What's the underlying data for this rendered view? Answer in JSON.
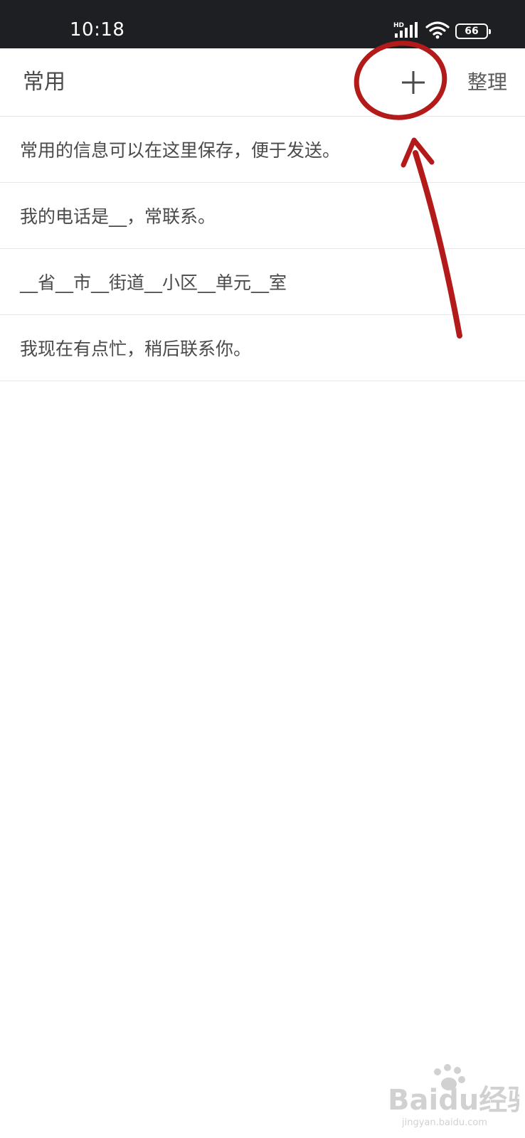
{
  "status_bar": {
    "time": "10:18",
    "network_label": "HD",
    "battery_level": "66",
    "icons": [
      "signal-icon",
      "wifi-icon",
      "battery-icon"
    ]
  },
  "header": {
    "title": "常用",
    "add_icon": "plus-icon",
    "organize_label": "整理"
  },
  "phrases": [
    "常用的信息可以在这里保存，便于发送。",
    "我的电话是__，常联系。",
    "__省__市__街道__小区__单元__室",
    "我现在有点忙，稍后联系你。"
  ],
  "annotation": {
    "color": "#b31b1b"
  },
  "watermark": {
    "brand": "Baidu经验",
    "url": "jingyan.baidu.com"
  },
  "colors": {
    "status_bar_bg": "#1e1f22",
    "text": "#4a4a4a",
    "divider": "#e8e8e8"
  }
}
